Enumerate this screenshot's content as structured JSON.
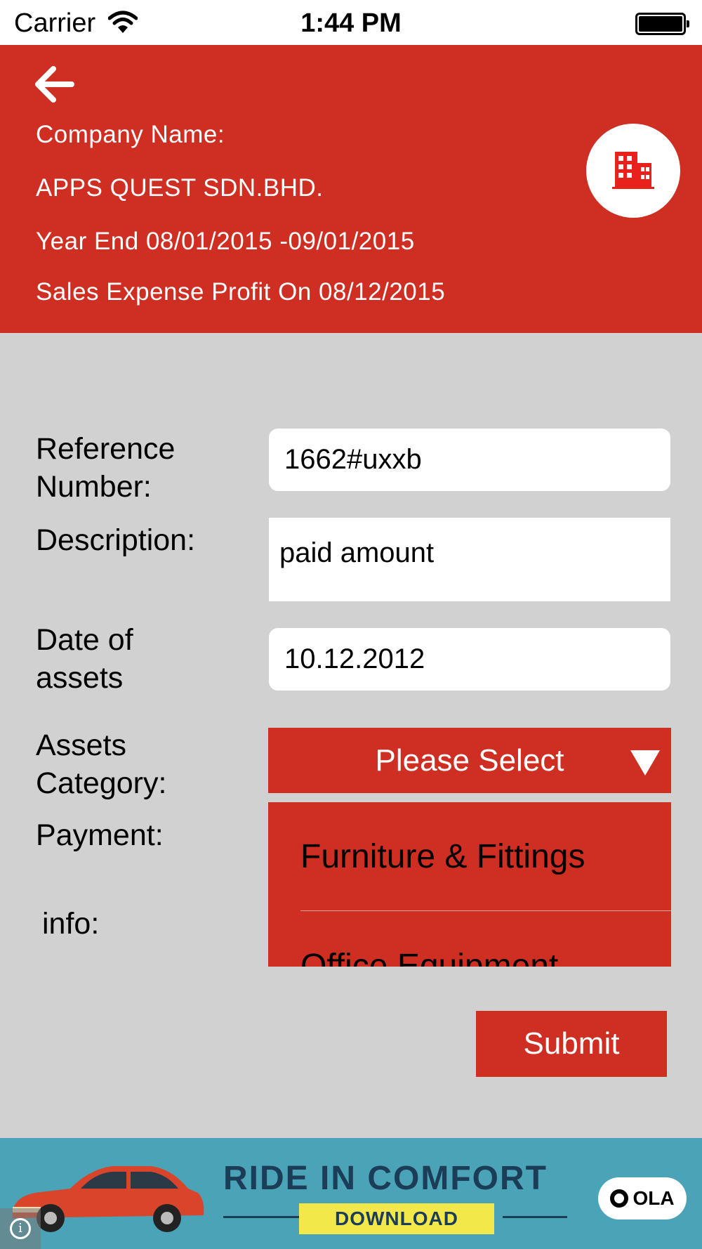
{
  "status_bar": {
    "carrier": "Carrier",
    "time": "1:44 PM"
  },
  "header": {
    "company_label": "Company Name:",
    "company_name": "APPS QUEST SDN.BHD.",
    "year_end": "Year End 08/01/2015 -09/01/2015",
    "sales_info": "Sales Expense Profit On 08/12/2015"
  },
  "form": {
    "reference_label": "Reference Number:",
    "reference_value": "1662#uxxb",
    "description_label": "Description:",
    "description_value": "paid amount",
    "date_label": "Date of assets",
    "date_value": "10.12.2012",
    "category_label": "Assets Category:",
    "category_select": "Please Select",
    "payment_label": "Payment:",
    "info_label": "info:",
    "dropdown_options": [
      "Furniture & Fittings",
      "Office Equipment"
    ],
    "submit_label": "Submit"
  },
  "ad": {
    "headline": "RIDE IN COMFORT",
    "cta": "DOWNLOAD",
    "brand": "OLA"
  },
  "colors": {
    "primary_red": "#cf2e22",
    "background_gray": "#d1d1d1",
    "ad_teal": "#4aa3b6"
  }
}
